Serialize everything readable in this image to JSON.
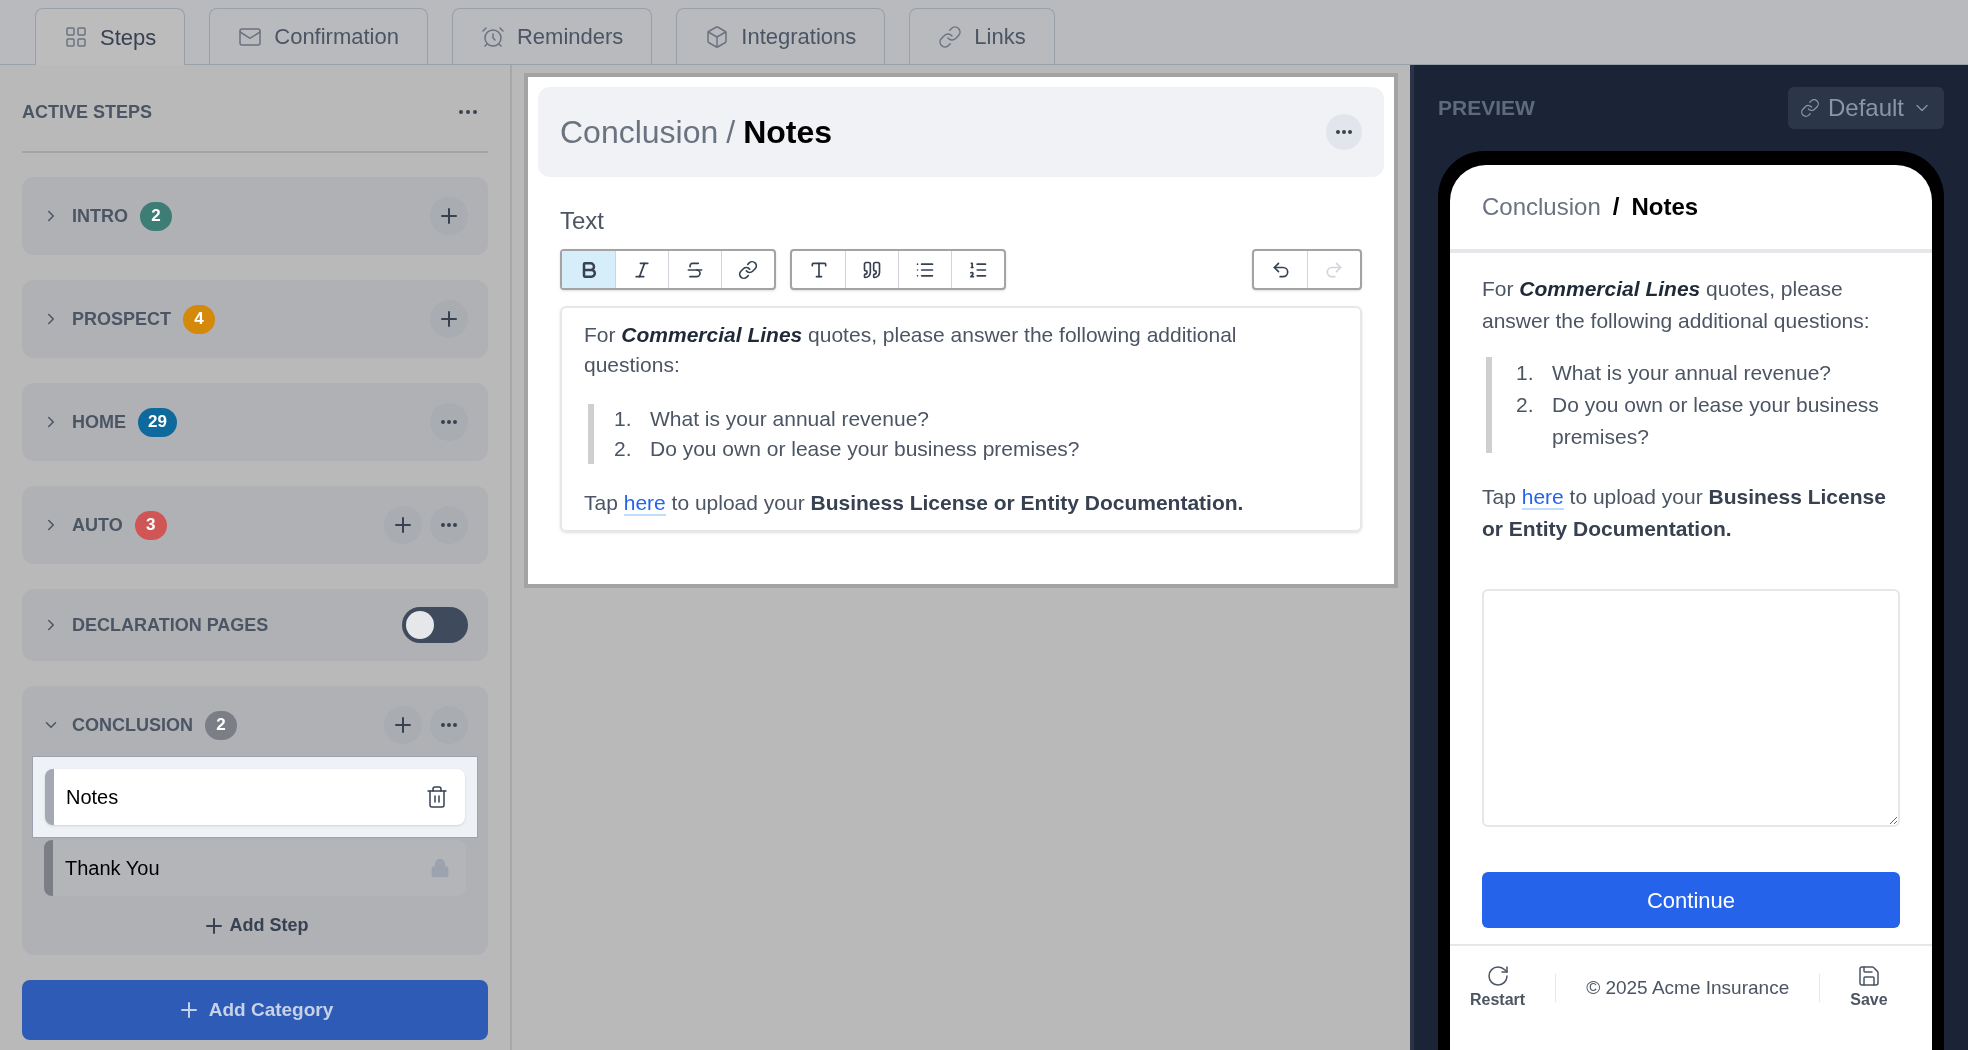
{
  "tabs": [
    {
      "label": "Steps",
      "selected": true
    },
    {
      "label": "Confirmation",
      "selected": false
    },
    {
      "label": "Reminders",
      "selected": false
    },
    {
      "label": "Integrations",
      "selected": false
    },
    {
      "label": "Links",
      "selected": false
    }
  ],
  "sidebar": {
    "title": "ACTIVE STEPS",
    "categories": [
      {
        "kind": "group",
        "name": "INTRO",
        "count": "2",
        "color": "#3d7d76",
        "expanded": false,
        "can_add": true,
        "has_menu": false
      },
      {
        "kind": "group",
        "name": "PROSPECT",
        "count": "4",
        "color": "#d4890a",
        "expanded": false,
        "can_add": true,
        "has_menu": false
      },
      {
        "kind": "group",
        "name": "HOME",
        "count": "29",
        "color": "#0e6a9c",
        "expanded": false,
        "can_add": false,
        "has_menu": true
      },
      {
        "kind": "group",
        "name": "AUTO",
        "count": "3",
        "color": "#d05656",
        "expanded": false,
        "can_add": true,
        "has_menu": true
      },
      {
        "kind": "toggle",
        "name": "DECLARATION PAGES",
        "expanded": false,
        "on": false
      },
      {
        "kind": "group",
        "name": "CONCLUSION",
        "count": "2",
        "color": "#7b7e85",
        "expanded": true,
        "can_add": true,
        "has_menu": true,
        "children": [
          {
            "label": "Notes",
            "selected": true,
            "locked": false
          },
          {
            "label": "Thank You",
            "selected": false,
            "locked": true
          }
        ],
        "add_step": "Add Step"
      }
    ],
    "add_category": "Add Category"
  },
  "editor": {
    "breadcrumb": {
      "parent": "Conclusion",
      "separator": "/",
      "current": "Notes"
    },
    "field_label": "Text",
    "toolbar_groups": [
      {
        "buttons": [
          {
            "kind": "bold",
            "active": true,
            "disabled": false
          },
          {
            "kind": "italic",
            "active": false,
            "disabled": false
          },
          {
            "kind": "strike",
            "active": false,
            "disabled": false
          },
          {
            "kind": "link",
            "active": false,
            "disabled": false
          }
        ]
      },
      {
        "buttons": [
          {
            "kind": "heading",
            "active": false,
            "disabled": false
          },
          {
            "kind": "quote",
            "active": false,
            "disabled": false
          },
          {
            "kind": "bullets",
            "active": false,
            "disabled": false
          },
          {
            "kind": "numbers",
            "active": false,
            "disabled": false
          }
        ]
      },
      {
        "buttons": [
          {
            "kind": "undo",
            "active": false,
            "disabled": false
          },
          {
            "kind": "redo",
            "active": false,
            "disabled": true
          }
        ]
      }
    ],
    "content": {
      "intro": "For *Commercial Lines* quotes, please answer the following additional questions:",
      "questions": [
        {
          "number": "1.",
          "text": "What is your annual revenue?"
        },
        {
          "number": "2.",
          "text": "Do you own or lease your business premises?"
        }
      ],
      "upload": {
        "before": "Tap ",
        "link": "here",
        "after": " to upload your **Business License or Entity Documentation.**"
      }
    }
  },
  "preview": {
    "title": "PREVIEW",
    "variant": "Default",
    "breadcrumb": {
      "parent": "Conclusion",
      "separator": "/",
      "current": "Notes"
    },
    "content": {
      "intro": "For *Commercial Lines* quotes, please answer the following additional questions:",
      "questions": [
        {
          "number": "1.",
          "text": "What is your annual revenue?"
        },
        {
          "number": "2.",
          "text": "Do you own or lease your business premises?"
        }
      ],
      "upload": {
        "before": "Tap ",
        "link": "here",
        "after": " to upload your **Business License or Entity Documentation.**"
      }
    },
    "continue": "Continue",
    "footer": {
      "restart": "Restart",
      "copyright": "© 2025 Acme Insurance",
      "save": "Save"
    }
  }
}
